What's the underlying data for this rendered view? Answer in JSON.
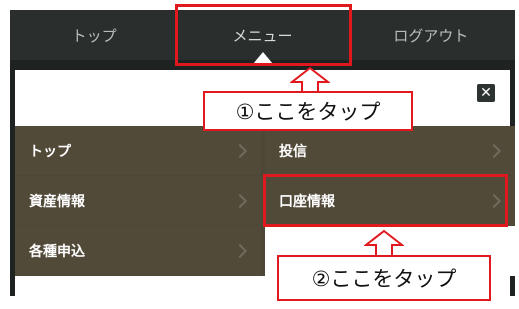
{
  "nav": {
    "tabs": [
      {
        "label": "トップ"
      },
      {
        "label": "メニュー"
      },
      {
        "label": "ログアウト"
      }
    ]
  },
  "menu": {
    "items": [
      {
        "label": "トップ"
      },
      {
        "label": "投信"
      },
      {
        "label": "資産情報"
      },
      {
        "label": "口座情報"
      },
      {
        "label": "各種申込"
      }
    ]
  },
  "annotations": {
    "callout1": "①ここをタップ",
    "callout2": "②ここをタップ",
    "highlight_color": "#e0191e"
  },
  "icons": {
    "close": "close-icon",
    "chevron": "chevron-right-icon"
  }
}
